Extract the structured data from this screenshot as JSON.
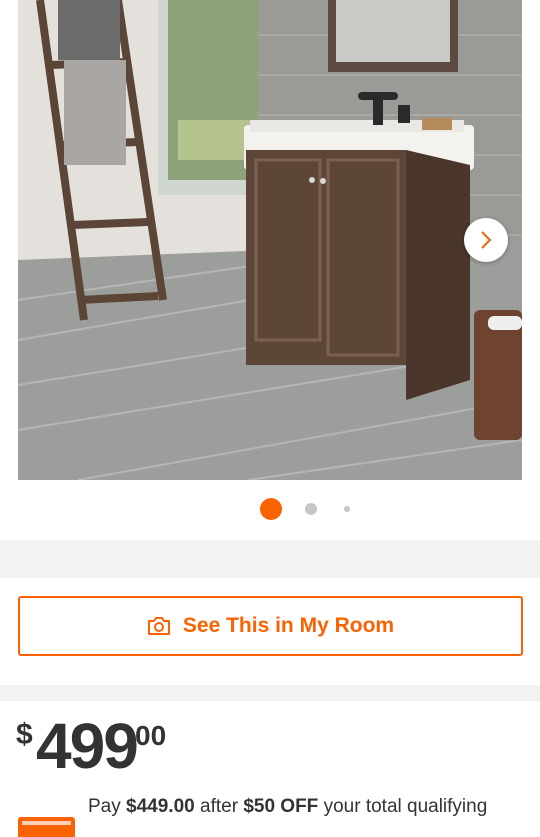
{
  "gallery": {
    "image_alt": "Bathroom vanity with white sink top, wooden ladder towel rack and wicker basket",
    "active_index": 1,
    "dot_count": 3,
    "next_icon": "chevron-right-icon"
  },
  "see_room": {
    "label": "See This in My Room",
    "icon": "camera-icon"
  },
  "price": {
    "currency": "$",
    "dollars": "499",
    "cents": "00"
  },
  "promo": {
    "pay": "Pay",
    "amount": "$449.00",
    "after": "after",
    "discount": "$50 OFF",
    "rest": "your total qualifying"
  },
  "colors": {
    "accent": "#f96302",
    "text": "#333333",
    "divider": "#f2f2f2"
  }
}
